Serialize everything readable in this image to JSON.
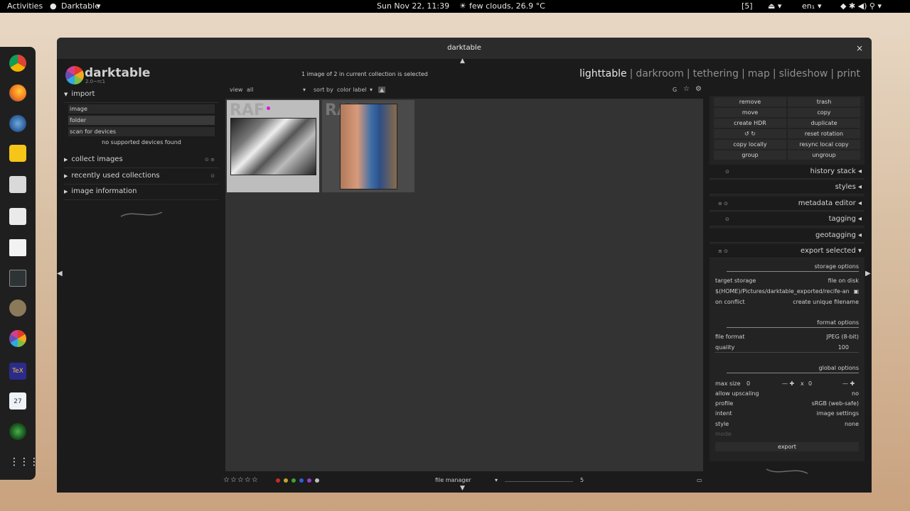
{
  "topbar": {
    "activities": "Activities",
    "app_name": "Darktable",
    "clock": "Sun Nov 22, 11:39",
    "weather": "few clouds, 26.9 °C",
    "workspace": "[5]",
    "lang": "en₁"
  },
  "dock": {
    "items": [
      "chrome-icon",
      "firefox-icon",
      "thunderbird-icon",
      "rhythmbox-icon",
      "files-icon",
      "store-icon",
      "text-editor-icon",
      "terminal-icon",
      "gimp-icon",
      "darktable-icon",
      "texmaker-icon",
      "calendar-icon",
      "camera-icon",
      "apps-grid-icon"
    ],
    "calendar_day": "27"
  },
  "window": {
    "title": "darktable",
    "close": "×"
  },
  "header": {
    "logo": "darktable",
    "version": "2.0~rc1",
    "selection_info": "1 image of 2 in current collection is selected",
    "views": [
      "lighttable",
      "darkroom",
      "tethering",
      "map",
      "slideshow",
      "print"
    ],
    "separator": "|"
  },
  "left": {
    "import_title": "import",
    "import_buttons": [
      "image",
      "folder",
      "scan for devices"
    ],
    "no_devices": "no supported devices found",
    "collect": "collect images",
    "recent": "recently used collections",
    "info": "image information"
  },
  "center_toolbar": {
    "view_label": "view",
    "view_value": "all",
    "sort_label": "sort by",
    "sort_value": "color label",
    "sort_order": "▲",
    "g_label": "G"
  },
  "thumbs": [
    {
      "ext": "RAF",
      "selected": true
    },
    {
      "ext": "RAF",
      "selected": false
    }
  ],
  "bottom": {
    "stars": "☆☆☆☆☆",
    "layout_mode": "file manager",
    "zoom": "5",
    "colors": [
      "#c42b2b",
      "#c0a52b",
      "#3aa52b",
      "#2b5fd1",
      "#9b3bd0",
      "#bdbdbd"
    ]
  },
  "right": {
    "buttons_left": [
      "remove",
      "move",
      "create HDR",
      "↺   ↻",
      "copy locally",
      "group"
    ],
    "buttons_right": [
      "trash",
      "copy",
      "duplicate",
      "reset rotation",
      "resync local copy",
      "ungroup"
    ],
    "sections": [
      "history stack",
      "styles",
      "metadata editor",
      "tagging",
      "geotagging",
      "export selected"
    ],
    "storage_options": "storage options",
    "target_storage_label": "target storage",
    "target_storage_value": "file on disk",
    "path": "$(HOME)/Pictures/darktable_exported/recife-an",
    "on_conflict_label": "on conflict",
    "on_conflict_value": "create unique filename",
    "format_options": "format options",
    "file_format_label": "file format",
    "file_format_value": "JPEG (8-bit)",
    "quality_label": "quality",
    "quality_value": "100",
    "global_options": "global options",
    "max_size_label": "max size",
    "max_w": "0",
    "max_h": "0",
    "x_label": "x",
    "upscaling_label": "allow upscaling",
    "upscaling_value": "no",
    "profile_label": "profile",
    "profile_value": "sRGB (web-safe)",
    "intent_label": "intent",
    "intent_value": "image settings",
    "style_label": "style",
    "style_value": "none",
    "mode_label": "mode",
    "export_button": "export"
  }
}
